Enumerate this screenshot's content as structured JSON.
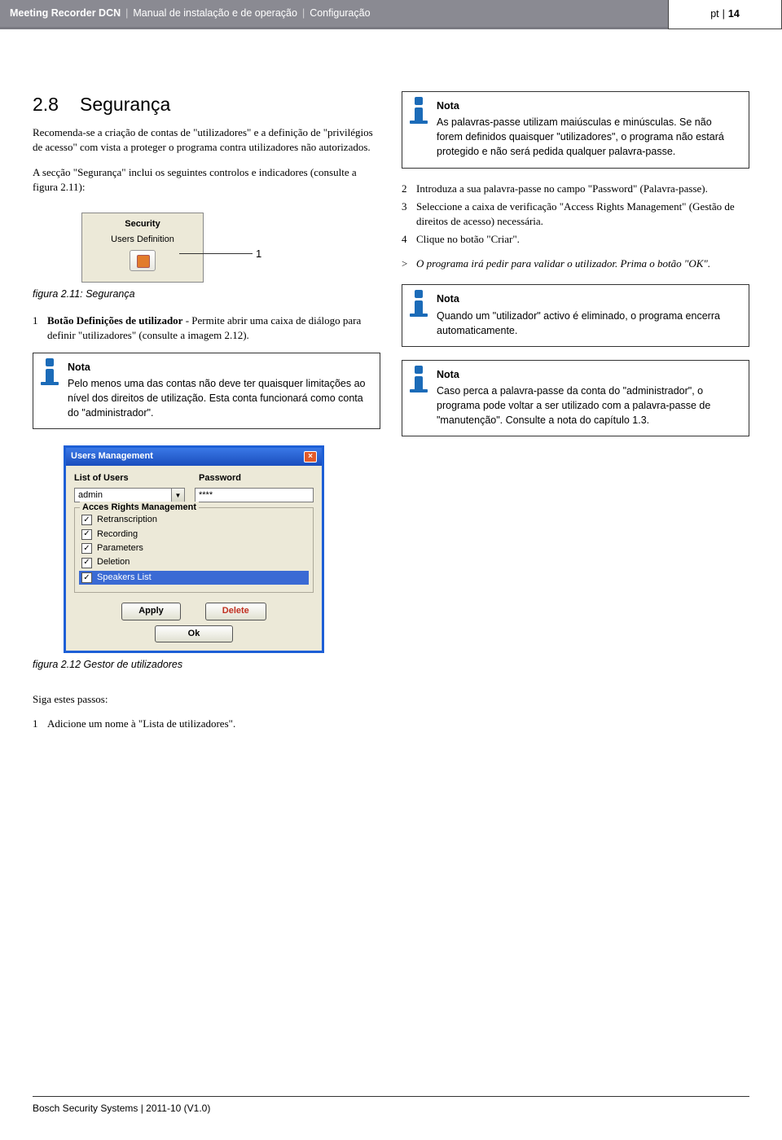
{
  "header": {
    "product": "Meeting Recorder DCN",
    "subtitle": "Manual de instalação e de operação",
    "section": "Configuração",
    "lang": "pt",
    "page": "14"
  },
  "section": {
    "number": "2.8",
    "title": "Segurança",
    "para1": "Recomenda-se a criação de contas de \"utilizadores\" e a definição de \"privilégios de acesso\" com vista a proteger o programa contra utilizadores não autorizados.",
    "para2": "A secção \"Segurança\" inclui os seguintes controlos e indicadores (consulte a figura 2.11):"
  },
  "fig211": {
    "panel_title": "Security",
    "panel_sub": "Users Definition",
    "callout": "1",
    "caption": "figura 2.11: Segurança"
  },
  "def1": {
    "n": "1",
    "label": "Botão Definições de utilizador",
    "text": " - Permite abrir uma caixa de diálogo para definir \"utilizadores\" (consulte a imagem 2.12)."
  },
  "notes": {
    "title": "Nota",
    "n1": "Pelo menos uma das contas não deve ter quaisquer limitações ao nível dos direitos de utilização. Esta conta funcionará como conta do \"administrador\".",
    "n2": "As palavras-passe utilizam maiúsculas e minúsculas. Se não forem definidos quaisquer \"utilizadores\", o programa não estará protegido e não será pedida qualquer palavra-passe.",
    "n3": "Quando um \"utilizador\" activo é eliminado, o programa encerra automaticamente.",
    "n4": "Caso perca a palavra-passe da conta do \"administrador\", o programa pode voltar a ser utilizado com a palavra-passe de \"manutenção\". Consulte a nota do capítulo 1.3."
  },
  "steps": {
    "s2": "Introduza a sua palavra-passe no campo \"Password\" (Palavra-passe).",
    "s3": "Seleccione a caixa de verificação \"Access Rights Management\" (Gestão de direitos de acesso) necessária.",
    "s4": "Clique no botão \"Criar\".",
    "gt": "O programa irá pedir para validar o utilizador. Prima o botão \"OK\"."
  },
  "um": {
    "title": "Users Management",
    "list_label": "List of Users",
    "pass_label": "Password",
    "user": "admin",
    "pass": "****",
    "group": "Acces Rights Management",
    "c1": "Retranscription",
    "c2": "Recording",
    "c3": "Parameters",
    "c4": "Deletion",
    "c5": "Speakers List",
    "apply": "Apply",
    "delete": "Delete",
    "ok": "Ok"
  },
  "fig212": {
    "caption": "figura 2.12 Gestor de utilizadores"
  },
  "follow": {
    "intro": "Siga estes passos:",
    "s1": "Adicione um nome à \"Lista de utilizadores\"."
  },
  "footer": "Bosch Security Systems | 2011-10 (V1.0)"
}
